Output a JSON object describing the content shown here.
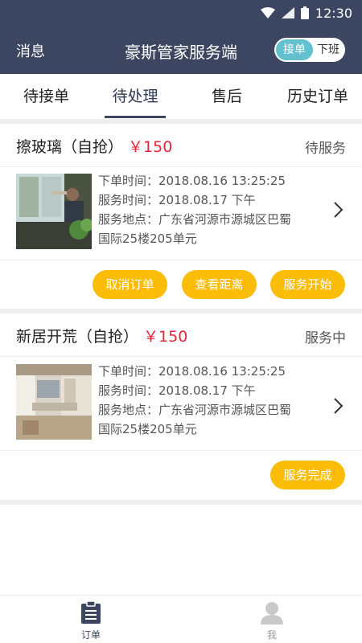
{
  "status_bar": {
    "time": "12:30"
  },
  "header": {
    "message_label": "消息",
    "title": "豪斯管家服务端",
    "toggle_on_label": "接单",
    "toggle_off_label": "下班"
  },
  "tabs": [
    {
      "label": "待接单"
    },
    {
      "label": "待处理"
    },
    {
      "label": "售后"
    },
    {
      "label": "历史订单"
    }
  ],
  "orders": [
    {
      "title": "擦玻璃（自抢）",
      "price": "￥150",
      "status": "待服务",
      "order_time": "下单时间：2018.08.16   13:25:25",
      "service_time": "服务时间：2018.08.17   下午",
      "address_line1": "服务地点：广东省河源市源城区巴蜀",
      "address_line2": "国际25楼205单元",
      "buttons": [
        {
          "label": "取消订单"
        },
        {
          "label": "查看距离"
        },
        {
          "label": "服务开始"
        }
      ]
    },
    {
      "title": "新居开荒（自抢）",
      "price": "￥150",
      "status": "服务中",
      "order_time": "下单时间：2018.08.16   13:25:25",
      "service_time": "服务时间：2018.08.17   下午",
      "address_line1": "服务地点：广东省河源市源城区巴蜀",
      "address_line2": "国际25楼205单元",
      "buttons": [
        {
          "label": "服务完成"
        }
      ]
    }
  ],
  "bottom_nav": [
    {
      "label": "订单"
    },
    {
      "label": "我"
    }
  ],
  "colors": {
    "header_bg": "#3c4661",
    "accent_button": "#fbbd08",
    "price": "#e3243a",
    "toggle_on": "#63c0cf"
  }
}
